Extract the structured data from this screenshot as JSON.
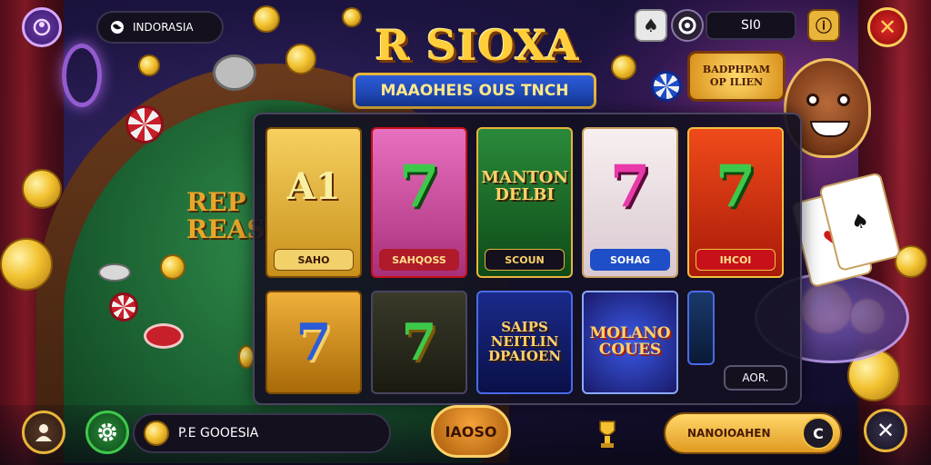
{
  "header": {
    "region_label": "INDORASIA",
    "title": "R SIOXA",
    "subtitle": "MAAOHEIS OUS TNCH",
    "balance_value": "SI0"
  },
  "promo": {
    "line1": "BADPHPAM",
    "line2": "OP ILIEN"
  },
  "table": {
    "text_line1": "REP",
    "text_line2": "REAS"
  },
  "games": {
    "row1": [
      {
        "art": "A1",
        "label": "SAHO",
        "label_bg": "#f2d06a",
        "label_color": "#3a1a04"
      },
      {
        "art": "7",
        "label": "SAHQOSS",
        "label_bg": "#b01a2a",
        "label_color": "#ffe08a"
      },
      {
        "art": "MANTON DELBI",
        "label": "SCOUN",
        "label_bg": "#14101e",
        "label_color": "#ffd26a"
      },
      {
        "art": "7",
        "label": "SOHAG",
        "label_bg": "#1e4ec8",
        "label_color": "#fff"
      },
      {
        "art": "7",
        "label": "IHCOI",
        "label_bg": "#c8101a",
        "label_color": "#ffe08a"
      }
    ],
    "row2": [
      {
        "art": "7"
      },
      {
        "art": "7"
      },
      {
        "art": "SAIPS NEITLIN DPAIOEN"
      },
      {
        "art": "MOLANO COUES"
      }
    ],
    "more_label": "AOR."
  },
  "bottom": {
    "search_value": "P.E GOOESIA",
    "play_label": "IAOSO",
    "claim_label": "NANOIOAHEN"
  },
  "icons": {
    "profile": "profile-icon",
    "region": "globe-icon",
    "deck": "cards-icon",
    "chip": "chip-icon",
    "info": "info-icon",
    "close": "close-icon",
    "user": "user-icon",
    "settings": "gear-icon",
    "coin": "coin-icon",
    "trophy": "trophy-icon"
  },
  "colors": {
    "gold": "#f2c230",
    "accent_purple": "#b06cf0",
    "felt": "#1a5e30",
    "banner_blue": "#2c5cd8"
  }
}
